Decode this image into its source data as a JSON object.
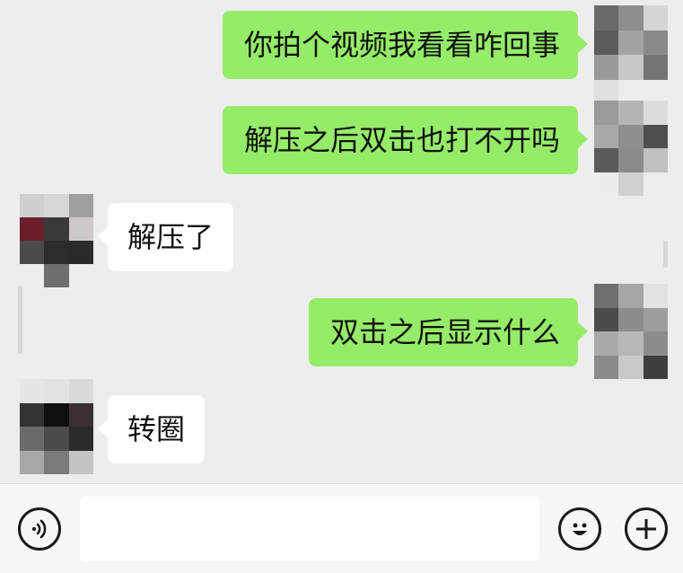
{
  "messages": [
    {
      "side": "out",
      "text": "你拍个视频我看看咋回事"
    },
    {
      "side": "out",
      "text": "解压之后双击也打不开吗"
    },
    {
      "side": "in",
      "text": "解压了"
    },
    {
      "side": "out",
      "text": "双击之后显示什么"
    },
    {
      "side": "in",
      "text": "转圈"
    }
  ],
  "input_bar": {
    "voice_icon": "voice-icon",
    "message_value": "",
    "emoji_icon": "emoji-icon",
    "add_icon": "plus-icon"
  },
  "colors": {
    "background": "#ededed",
    "outgoing_bubble": "#95ec69",
    "incoming_bubble": "#ffffff",
    "input_bar": "#f7f7f7"
  }
}
